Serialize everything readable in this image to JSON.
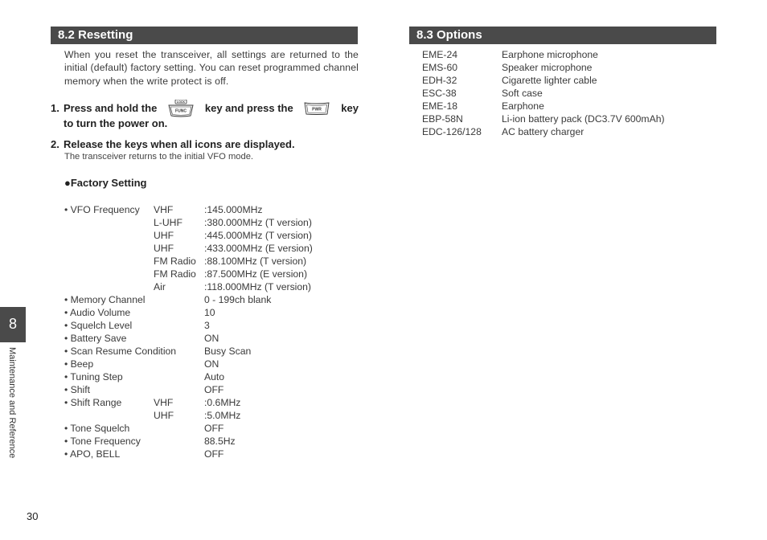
{
  "resetting": {
    "title": "8.2 Resetting",
    "intro": "When you reset the transceiver, all settings are returned to the initial (default) factory setting. You can reset programmed channel memory when the write protect is off.",
    "step1": {
      "number": "1.",
      "text_a": "Press and hold the",
      "key1": {
        "label": "FUNC",
        "sub_label": "LOCK",
        "icon": "func-key-icon"
      },
      "text_b": "key and press the",
      "key2": {
        "label": "PWR",
        "icon": "pwr-key-icon"
      },
      "text_c": "key",
      "line2": "to turn the power on."
    },
    "step2": {
      "number": "2.",
      "text": "Release the keys when all icons are displayed.",
      "note": "The transceiver returns to the initial VFO mode."
    },
    "factory_title": "●Factory Setting",
    "settings": [
      {
        "name": "• VFO Frequency",
        "band": "VHF",
        "value": ":145.000MHz"
      },
      {
        "name": "",
        "band": "L-UHF",
        "value": ":380.000MHz (T version)"
      },
      {
        "name": "",
        "band": "UHF",
        "value": ":445.000MHz (T version)"
      },
      {
        "name": "",
        "band": "UHF",
        "value": ":433.000MHz (E version)"
      },
      {
        "name": "",
        "band": "FM Radio",
        "value": ":88.100MHz (T version)"
      },
      {
        "name": "",
        "band": "FM Radio",
        "value": ":87.500MHz (E version)"
      },
      {
        "name": "",
        "band": "Air",
        "value": ":118.000MHz (T version)"
      },
      {
        "name": "• Memory Channel",
        "band": "",
        "value": "0 - 199ch blank"
      },
      {
        "name": "• Audio Volume",
        "band": "",
        "value": "10"
      },
      {
        "name": "• Squelch Level",
        "band": "",
        "value": "3"
      },
      {
        "name": "• Battery Save",
        "band": "",
        "value": "ON"
      },
      {
        "name": "• Scan Resume Condition",
        "band": "",
        "value": "Busy Scan"
      },
      {
        "name": "• Beep",
        "band": "",
        "value": "ON"
      },
      {
        "name": "• Tuning Step",
        "band": "",
        "value": "Auto"
      },
      {
        "name": "• Shift",
        "band": "",
        "value": "OFF"
      },
      {
        "name": "• Shift Range",
        "band": "VHF",
        "value": ":0.6MHz"
      },
      {
        "name": "",
        "band": "UHF",
        "value": ":5.0MHz"
      },
      {
        "name": "• Tone Squelch",
        "band": "",
        "value": "OFF"
      },
      {
        "name": "• Tone Frequency",
        "band": "",
        "value": "88.5Hz"
      },
      {
        "name": "• APO, BELL",
        "band": "",
        "value": "OFF"
      }
    ]
  },
  "options": {
    "title": "8.3 Options",
    "items": [
      {
        "model": "EME-24",
        "desc": "Earphone microphone"
      },
      {
        "model": "EMS-60",
        "desc": "Speaker microphone"
      },
      {
        "model": "EDH-32",
        "desc": "Cigarette lighter cable"
      },
      {
        "model": "ESC-38",
        "desc": "Soft case"
      },
      {
        "model": "EME-18",
        "desc": "Earphone"
      },
      {
        "model": "EBP-58N",
        "desc": "Li-ion battery pack (DC3.7V 600mAh)"
      },
      {
        "model": "EDC-126/128",
        "desc": "AC battery charger"
      }
    ]
  },
  "side_tab": {
    "number": "8",
    "label": "Maintenance and Reference"
  },
  "page_number": "30"
}
